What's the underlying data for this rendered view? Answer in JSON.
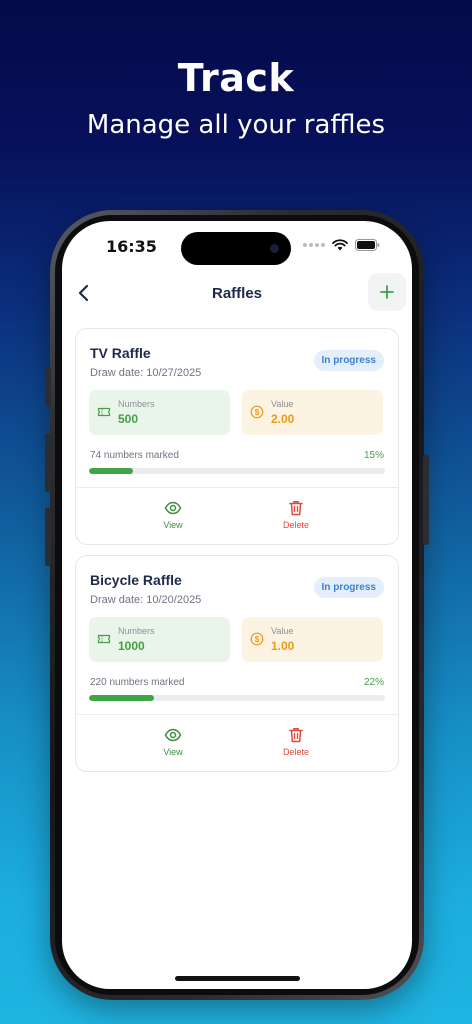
{
  "promo": {
    "title": "Track",
    "subtitle": "Manage all your raffles"
  },
  "status_bar": {
    "time": "16:35"
  },
  "nav": {
    "title": "Raffles",
    "back_icon": "chevron-left-icon",
    "add_icon": "plus-icon"
  },
  "colors": {
    "accent_green": "#43a047",
    "accent_orange": "#ed9a19",
    "badge_blue": "#3d7fd3",
    "delete_red": "#e5473a"
  },
  "raffles": [
    {
      "name": "TV Raffle",
      "draw_date": "Draw date: 10/27/2025",
      "status": "In progress",
      "numbers_label": "Numbers",
      "numbers": "500",
      "value_label": "Value",
      "value": "2.00",
      "marked": "74 numbers marked",
      "percent": "15%",
      "progress": 0.15,
      "view_label": "View",
      "delete_label": "Delete"
    },
    {
      "name": "Bicycle Raffle",
      "draw_date": "Draw date: 10/20/2025",
      "status": "In progress",
      "numbers_label": "Numbers",
      "numbers": "1000",
      "value_label": "Value",
      "value": "1.00",
      "marked": "220 numbers marked",
      "percent": "22%",
      "progress": 0.22,
      "view_label": "View",
      "delete_label": "Delete"
    }
  ]
}
